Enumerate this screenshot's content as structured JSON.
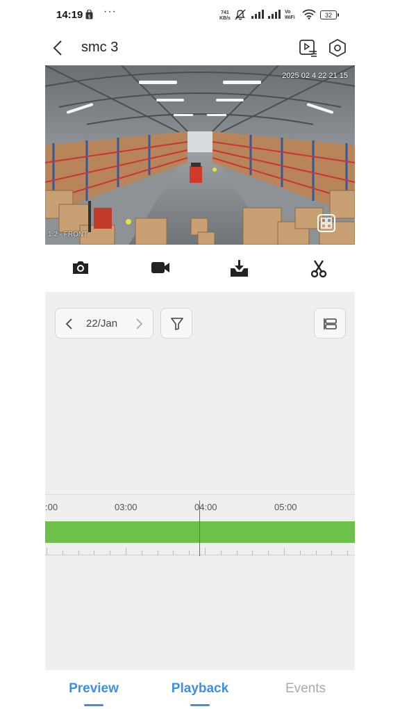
{
  "status_bar": {
    "time": "14:19",
    "more": "···",
    "net_speed_value": "741",
    "net_speed_unit": "KB/s",
    "vowifi_top": "Vo",
    "vowifi_bottom": "WiFi",
    "battery": "32"
  },
  "header": {
    "title": "smc 3"
  },
  "video": {
    "timestamp": "2025 02 4 22 21 15",
    "channel_label": "1.2 - FRONT"
  },
  "date": {
    "value": "22/Jan"
  },
  "timeline": {
    "labels": [
      ":00",
      "03:00",
      "04:00",
      "05:00"
    ],
    "recording_color": "#6ec04d"
  },
  "nav": {
    "tabs": [
      "Preview",
      "Playback",
      "Events"
    ],
    "active_color": "#3d8fe0"
  }
}
